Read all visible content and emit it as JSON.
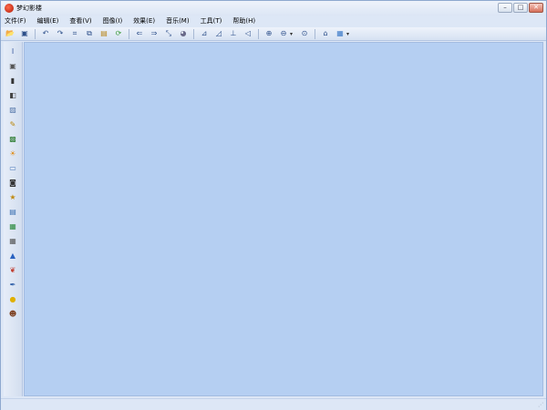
{
  "window": {
    "title": "梦幻影楼",
    "buttons": [
      "minimize",
      "maximize",
      "close"
    ]
  },
  "menubar": {
    "items": [
      {
        "label": "文件(F)"
      },
      {
        "label": "编辑(E)"
      },
      {
        "label": "查看(V)"
      },
      {
        "label": "图像(I)"
      },
      {
        "label": "效果(E)"
      },
      {
        "label": "音乐(M)"
      },
      {
        "label": "工具(T)"
      },
      {
        "label": "帮助(H)"
      }
    ]
  },
  "toolbar": {
    "groups": [
      [
        "open-icon",
        "save-icon"
      ],
      [
        "undo-icon",
        "redo-icon",
        "crop-icon",
        "copy-icon",
        "paste-icon",
        "refresh-icon"
      ],
      [
        "arrow-left-icon",
        "arrow-right-icon",
        "resize-icon",
        "sphere-icon"
      ],
      [
        "align-left-icon",
        "align-right-icon",
        "align-center-icon",
        "align-edge-icon"
      ],
      [
        "zoom-in-icon",
        "zoom-out-icon",
        "zoom-fit-icon"
      ],
      [
        "home-icon",
        "image-view-icon"
      ]
    ]
  },
  "sidebar": {
    "icons": [
      "text-cursor-icon",
      "frame-icon",
      "film-icon",
      "half-tone-icon",
      "picture-icon",
      "pencil-icon",
      "landscape-icon",
      "sun-image-icon",
      "window-icon",
      "camera-icon",
      "star-image-icon",
      "photo-frame-icon",
      "mosaic-icon",
      "grid-icon",
      "triangle-icon",
      "bow-icon",
      "feather-icon",
      "bulb-icon",
      "face-icon"
    ]
  },
  "colors": {
    "canvas": "#b5cff2",
    "chrome": "#dde7f6",
    "close_button": "#d6705b"
  }
}
